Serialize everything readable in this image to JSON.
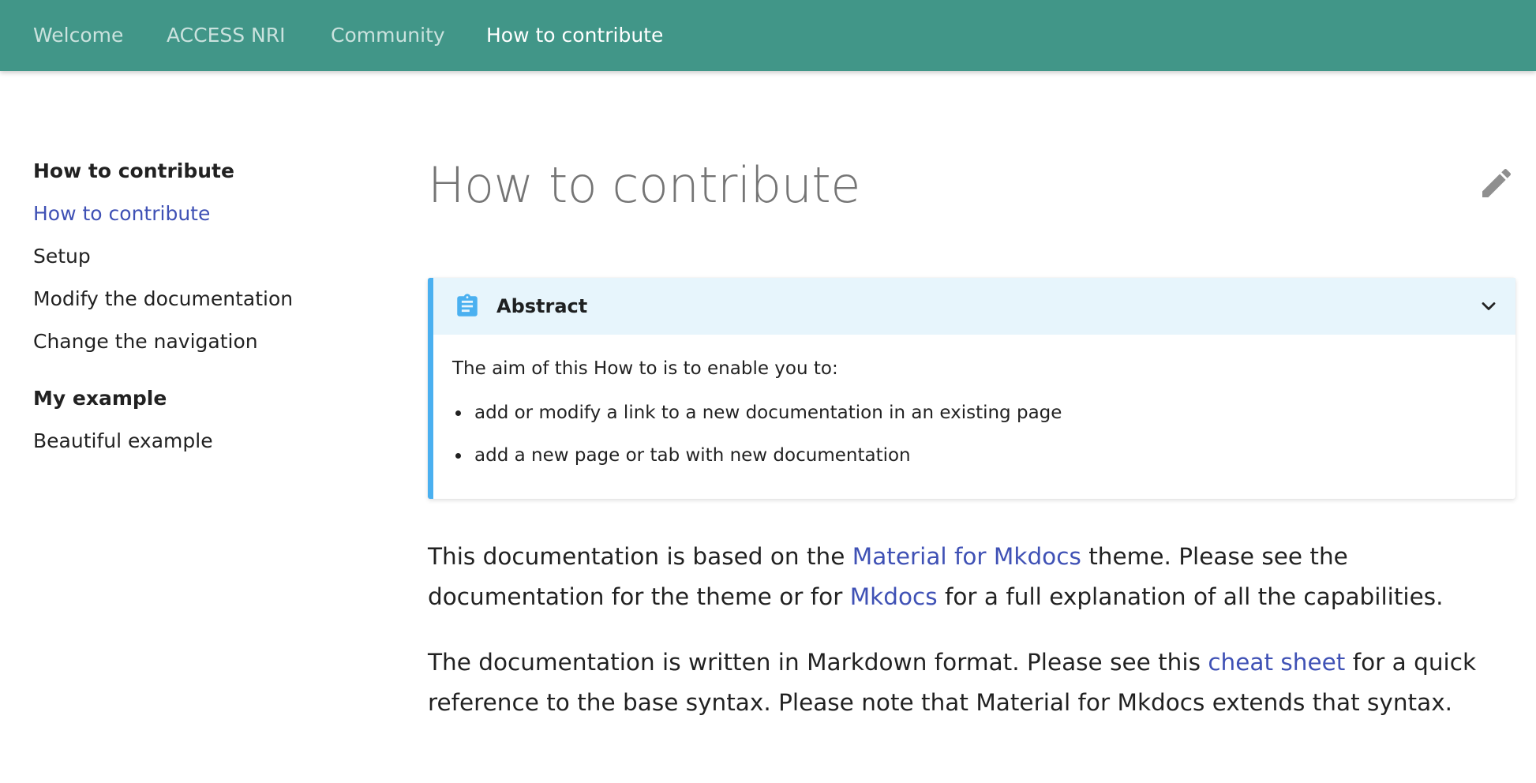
{
  "tabs": [
    {
      "label": "Welcome"
    },
    {
      "label": "ACCESS NRI"
    },
    {
      "label": "Community"
    },
    {
      "label": "How to contribute"
    }
  ],
  "sidebar": {
    "sections": [
      {
        "title": "How to contribute",
        "items": [
          "How to contribute",
          "Setup",
          "Modify the documentation",
          "Change the navigation"
        ]
      },
      {
        "title": "My example",
        "items": [
          "Beautiful example"
        ]
      }
    ]
  },
  "main": {
    "title": "How to contribute",
    "edit_icon": "pencil-icon",
    "admonition": {
      "title": "Abstract",
      "icon": "clipboard-list-icon",
      "intro": "The aim of this How to is to enable you to:",
      "bullets": [
        "add or modify a link to a new documentation in an existing page",
        "add a new page or tab with new documentation"
      ]
    },
    "para1": {
      "t1": "This documentation is based on the ",
      "link1": "Material for Mkdocs",
      "t2": " theme. Please see the documentation for the theme or for ",
      "link2": "Mkdocs",
      "t3": " for a full explanation of all the capabilities."
    },
    "para2": {
      "t1": "The documentation is written in Markdown format. Please see this ",
      "link1": "cheat sheet",
      "t2": " for a quick reference to the base syntax. Please note that Material for Mkdocs extends that syntax."
    }
  },
  "colors": {
    "header_bg": "#419688",
    "link": "#3f51b5",
    "admonition_border": "#4ab0f0",
    "admonition_head_bg": "#e7f5fc"
  }
}
